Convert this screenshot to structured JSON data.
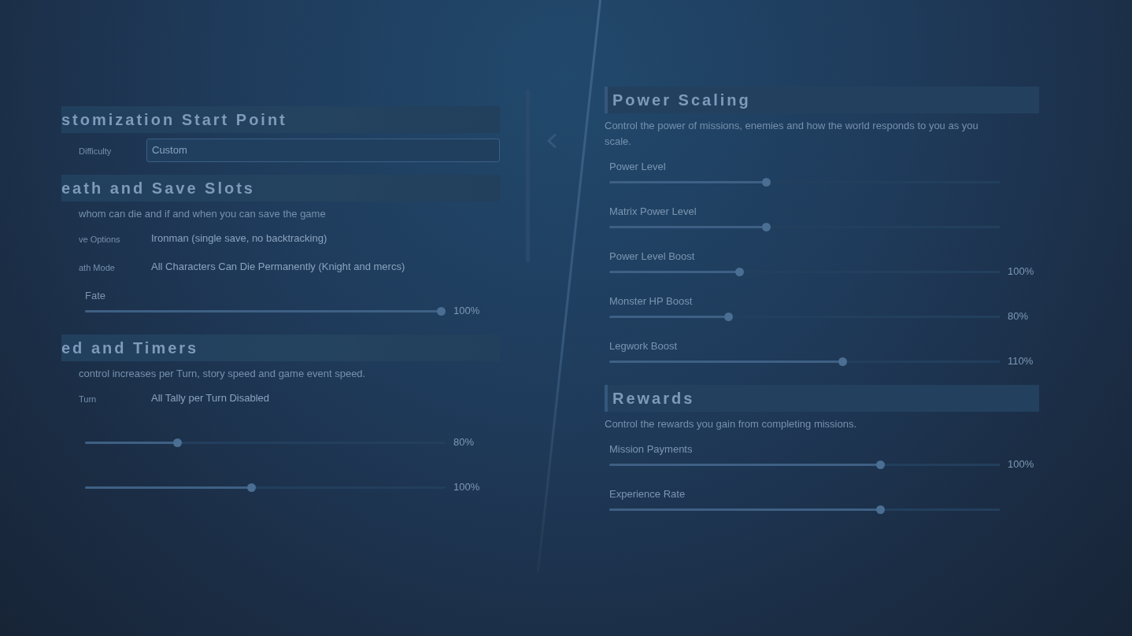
{
  "left_panel": {
    "sections": [
      {
        "title": "stomization Start Point",
        "rows": [
          {
            "kind": "dropdown",
            "label": "Difficulty",
            "value": "Custom"
          }
        ]
      },
      {
        "title": "eath and Save Slots",
        "description": "whom can die and if and when you can save the game",
        "rows": [
          {
            "kind": "option",
            "label": "ve Options",
            "value": "Ironman (single save, no backtracking)"
          },
          {
            "kind": "option",
            "label": "ath Mode",
            "value": "All Characters Can Die Permanently (Knight and mercs)"
          },
          {
            "kind": "slider",
            "label": "Fate",
            "level": 1,
            "reading": "100%"
          }
        ]
      },
      {
        "title": "ed and Timers",
        "description": "control increases per Turn, story speed and game event speed.",
        "rows": [
          {
            "kind": "option",
            "label": "Turn",
            "value": "All Tally per Turn Disabled"
          },
          {
            "kind": "slider",
            "level": 0.25,
            "reading": "80%"
          },
          {
            "kind": "slider",
            "level": 0.46,
            "reading": "100%"
          }
        ]
      }
    ]
  },
  "right_panel": {
    "sections": [
      {
        "title": "Power Scaling",
        "description": "Control the power of missions, enemies and how the world responds to you as you scale.",
        "rows": [
          {
            "kind": "slider",
            "label": "Power Level",
            "level": 0.4
          },
          {
            "kind": "slider",
            "label": "Matrix Power Level",
            "level": 0.4
          },
          {
            "kind": "slider",
            "label": "Power Level Boost",
            "level": 0.33,
            "reading": "100%"
          },
          {
            "kind": "slider",
            "label": "Monster HP Boost",
            "level": 0.3,
            "reading": "80%"
          },
          {
            "kind": "slider",
            "label": "Legwork Boost",
            "level": 0.6,
            "reading": "110%"
          }
        ]
      },
      {
        "title": "Rewards",
        "description": "Control the rewards you gain from completing missions.",
        "rows": [
          {
            "kind": "slider",
            "label": "Mission Payments",
            "level": 0.7,
            "reading": "100%"
          },
          {
            "kind": "slider",
            "label": "Experience Rate",
            "level": 0.7
          }
        ]
      }
    ]
  }
}
